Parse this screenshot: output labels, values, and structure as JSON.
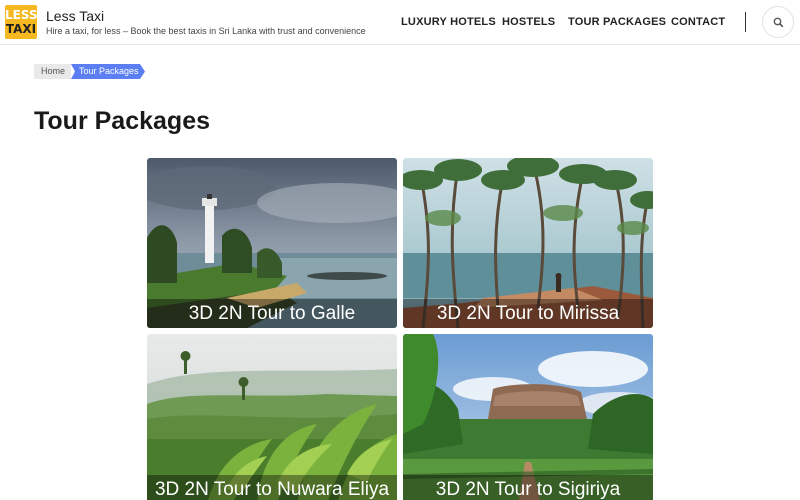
{
  "header": {
    "logo_line1": "LESS",
    "logo_line2": "TAXI",
    "site_title": "Less Taxi",
    "tagline": "Hire a taxi, for less – Book the best taxis in Sri Lanka with trust and convenience",
    "nav": [
      "LUXURY HOTELS",
      "HOSTELS",
      "TOUR PACKAGES",
      "CONTACT"
    ],
    "search_icon": "search-icon"
  },
  "breadcrumb": {
    "home": "Home",
    "current": "Tour Packages",
    "accent_color": "#5b7ff2"
  },
  "page_title": "Tour Packages",
  "packages": [
    {
      "title": "3D 2N Tour to Galle",
      "image": "lighthouse-coast"
    },
    {
      "title": "3D 2N Tour to Mirissa",
      "image": "palm-beach"
    },
    {
      "title": "3D 2N Tour to Nuwara Eliya",
      "image": "tea-plantation"
    },
    {
      "title": "3D 2N Tour to Sigiriya",
      "image": "rock-fortress"
    }
  ],
  "colors": {
    "logo_bg": "#f6b81f",
    "overlay": "rgba(0,0,0,0.38)"
  }
}
